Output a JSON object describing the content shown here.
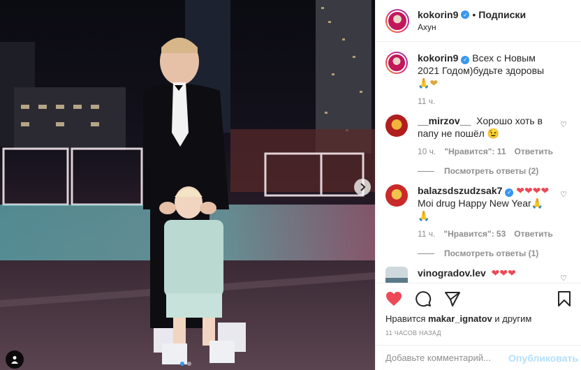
{
  "post": {
    "author": "kokorin9",
    "follow_label": "Подписки",
    "separator": "•",
    "location": "Ахун"
  },
  "caption": {
    "username": "kokorin9",
    "text": "Всех с Новым 2021 Годом)будьте здоровы",
    "emojis": "🙏❤",
    "time": "11 ч."
  },
  "comments": [
    {
      "username": "__mirzov__",
      "text": "Хорошо хоть в папу не пошёл",
      "emojis": "😉",
      "time": "10 ч.",
      "likes": "\"Нравится\": 11",
      "reply": "Ответить",
      "view_replies": "Посмотреть ответы (2)"
    },
    {
      "username": "balazsdszudzsak7",
      "text": "Moi drug Happy New Year",
      "emojis_before": "❤❤❤❤",
      "emojis": "🙏🙏",
      "time": "11 ч.",
      "likes": "\"Нравится\": 53",
      "reply": "Ответить",
      "view_replies": "Посмотреть ответы (1)"
    },
    {
      "username": "vinogradov.lev",
      "text": "",
      "emojis_before": "❤❤❤"
    }
  ],
  "likes": {
    "prefix": "Нравится",
    "user": "makar_ignatov",
    "suffix": "и другим"
  },
  "timestamp": "11 ЧАСОВ НАЗАД",
  "comment_box": {
    "placeholder": "Добавьте комментарий...",
    "publish": "Опубликовать"
  },
  "carousel": {
    "slides": 2,
    "active": 0
  },
  "icons": {
    "like": "heart-filled-icon",
    "comment": "comment-icon",
    "share": "send-icon",
    "save": "bookmark-icon",
    "next": "chevron-right-icon",
    "tag": "person-tag-icon",
    "verified": "verified-badge-icon"
  },
  "colors": {
    "like_red": "#ed4956",
    "verified_blue": "#3897f0",
    "publish_disabled": "#b2dffc",
    "muted_text": "#8e8e8e"
  }
}
